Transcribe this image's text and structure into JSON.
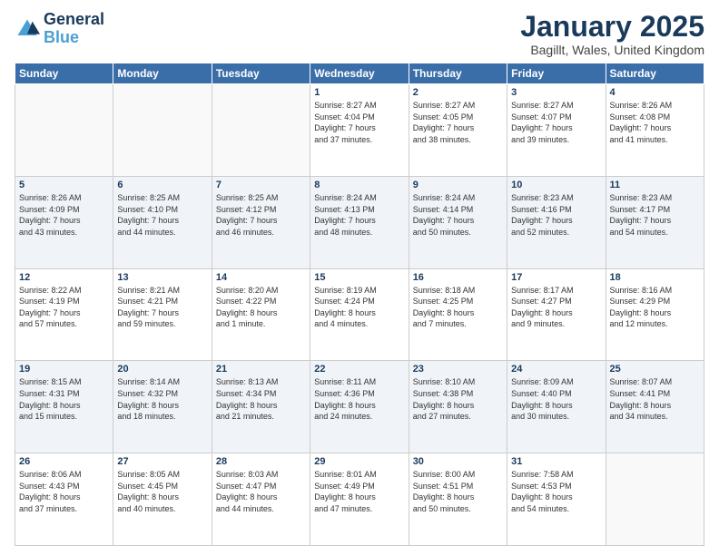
{
  "header": {
    "logo_line1": "General",
    "logo_line2": "Blue",
    "title": "January 2025",
    "subtitle": "Bagillt, Wales, United Kingdom"
  },
  "weekdays": [
    "Sunday",
    "Monday",
    "Tuesday",
    "Wednesday",
    "Thursday",
    "Friday",
    "Saturday"
  ],
  "weeks": [
    [
      {
        "day": "",
        "info": ""
      },
      {
        "day": "",
        "info": ""
      },
      {
        "day": "",
        "info": ""
      },
      {
        "day": "1",
        "info": "Sunrise: 8:27 AM\nSunset: 4:04 PM\nDaylight: 7 hours\nand 37 minutes."
      },
      {
        "day": "2",
        "info": "Sunrise: 8:27 AM\nSunset: 4:05 PM\nDaylight: 7 hours\nand 38 minutes."
      },
      {
        "day": "3",
        "info": "Sunrise: 8:27 AM\nSunset: 4:07 PM\nDaylight: 7 hours\nand 39 minutes."
      },
      {
        "day": "4",
        "info": "Sunrise: 8:26 AM\nSunset: 4:08 PM\nDaylight: 7 hours\nand 41 minutes."
      }
    ],
    [
      {
        "day": "5",
        "info": "Sunrise: 8:26 AM\nSunset: 4:09 PM\nDaylight: 7 hours\nand 43 minutes."
      },
      {
        "day": "6",
        "info": "Sunrise: 8:25 AM\nSunset: 4:10 PM\nDaylight: 7 hours\nand 44 minutes."
      },
      {
        "day": "7",
        "info": "Sunrise: 8:25 AM\nSunset: 4:12 PM\nDaylight: 7 hours\nand 46 minutes."
      },
      {
        "day": "8",
        "info": "Sunrise: 8:24 AM\nSunset: 4:13 PM\nDaylight: 7 hours\nand 48 minutes."
      },
      {
        "day": "9",
        "info": "Sunrise: 8:24 AM\nSunset: 4:14 PM\nDaylight: 7 hours\nand 50 minutes."
      },
      {
        "day": "10",
        "info": "Sunrise: 8:23 AM\nSunset: 4:16 PM\nDaylight: 7 hours\nand 52 minutes."
      },
      {
        "day": "11",
        "info": "Sunrise: 8:23 AM\nSunset: 4:17 PM\nDaylight: 7 hours\nand 54 minutes."
      }
    ],
    [
      {
        "day": "12",
        "info": "Sunrise: 8:22 AM\nSunset: 4:19 PM\nDaylight: 7 hours\nand 57 minutes."
      },
      {
        "day": "13",
        "info": "Sunrise: 8:21 AM\nSunset: 4:21 PM\nDaylight: 7 hours\nand 59 minutes."
      },
      {
        "day": "14",
        "info": "Sunrise: 8:20 AM\nSunset: 4:22 PM\nDaylight: 8 hours\nand 1 minute."
      },
      {
        "day": "15",
        "info": "Sunrise: 8:19 AM\nSunset: 4:24 PM\nDaylight: 8 hours\nand 4 minutes."
      },
      {
        "day": "16",
        "info": "Sunrise: 8:18 AM\nSunset: 4:25 PM\nDaylight: 8 hours\nand 7 minutes."
      },
      {
        "day": "17",
        "info": "Sunrise: 8:17 AM\nSunset: 4:27 PM\nDaylight: 8 hours\nand 9 minutes."
      },
      {
        "day": "18",
        "info": "Sunrise: 8:16 AM\nSunset: 4:29 PM\nDaylight: 8 hours\nand 12 minutes."
      }
    ],
    [
      {
        "day": "19",
        "info": "Sunrise: 8:15 AM\nSunset: 4:31 PM\nDaylight: 8 hours\nand 15 minutes."
      },
      {
        "day": "20",
        "info": "Sunrise: 8:14 AM\nSunset: 4:32 PM\nDaylight: 8 hours\nand 18 minutes."
      },
      {
        "day": "21",
        "info": "Sunrise: 8:13 AM\nSunset: 4:34 PM\nDaylight: 8 hours\nand 21 minutes."
      },
      {
        "day": "22",
        "info": "Sunrise: 8:11 AM\nSunset: 4:36 PM\nDaylight: 8 hours\nand 24 minutes."
      },
      {
        "day": "23",
        "info": "Sunrise: 8:10 AM\nSunset: 4:38 PM\nDaylight: 8 hours\nand 27 minutes."
      },
      {
        "day": "24",
        "info": "Sunrise: 8:09 AM\nSunset: 4:40 PM\nDaylight: 8 hours\nand 30 minutes."
      },
      {
        "day": "25",
        "info": "Sunrise: 8:07 AM\nSunset: 4:41 PM\nDaylight: 8 hours\nand 34 minutes."
      }
    ],
    [
      {
        "day": "26",
        "info": "Sunrise: 8:06 AM\nSunset: 4:43 PM\nDaylight: 8 hours\nand 37 minutes."
      },
      {
        "day": "27",
        "info": "Sunrise: 8:05 AM\nSunset: 4:45 PM\nDaylight: 8 hours\nand 40 minutes."
      },
      {
        "day": "28",
        "info": "Sunrise: 8:03 AM\nSunset: 4:47 PM\nDaylight: 8 hours\nand 44 minutes."
      },
      {
        "day": "29",
        "info": "Sunrise: 8:01 AM\nSunset: 4:49 PM\nDaylight: 8 hours\nand 47 minutes."
      },
      {
        "day": "30",
        "info": "Sunrise: 8:00 AM\nSunset: 4:51 PM\nDaylight: 8 hours\nand 50 minutes."
      },
      {
        "day": "31",
        "info": "Sunrise: 7:58 AM\nSunset: 4:53 PM\nDaylight: 8 hours\nand 54 minutes."
      },
      {
        "day": "",
        "info": ""
      }
    ]
  ]
}
